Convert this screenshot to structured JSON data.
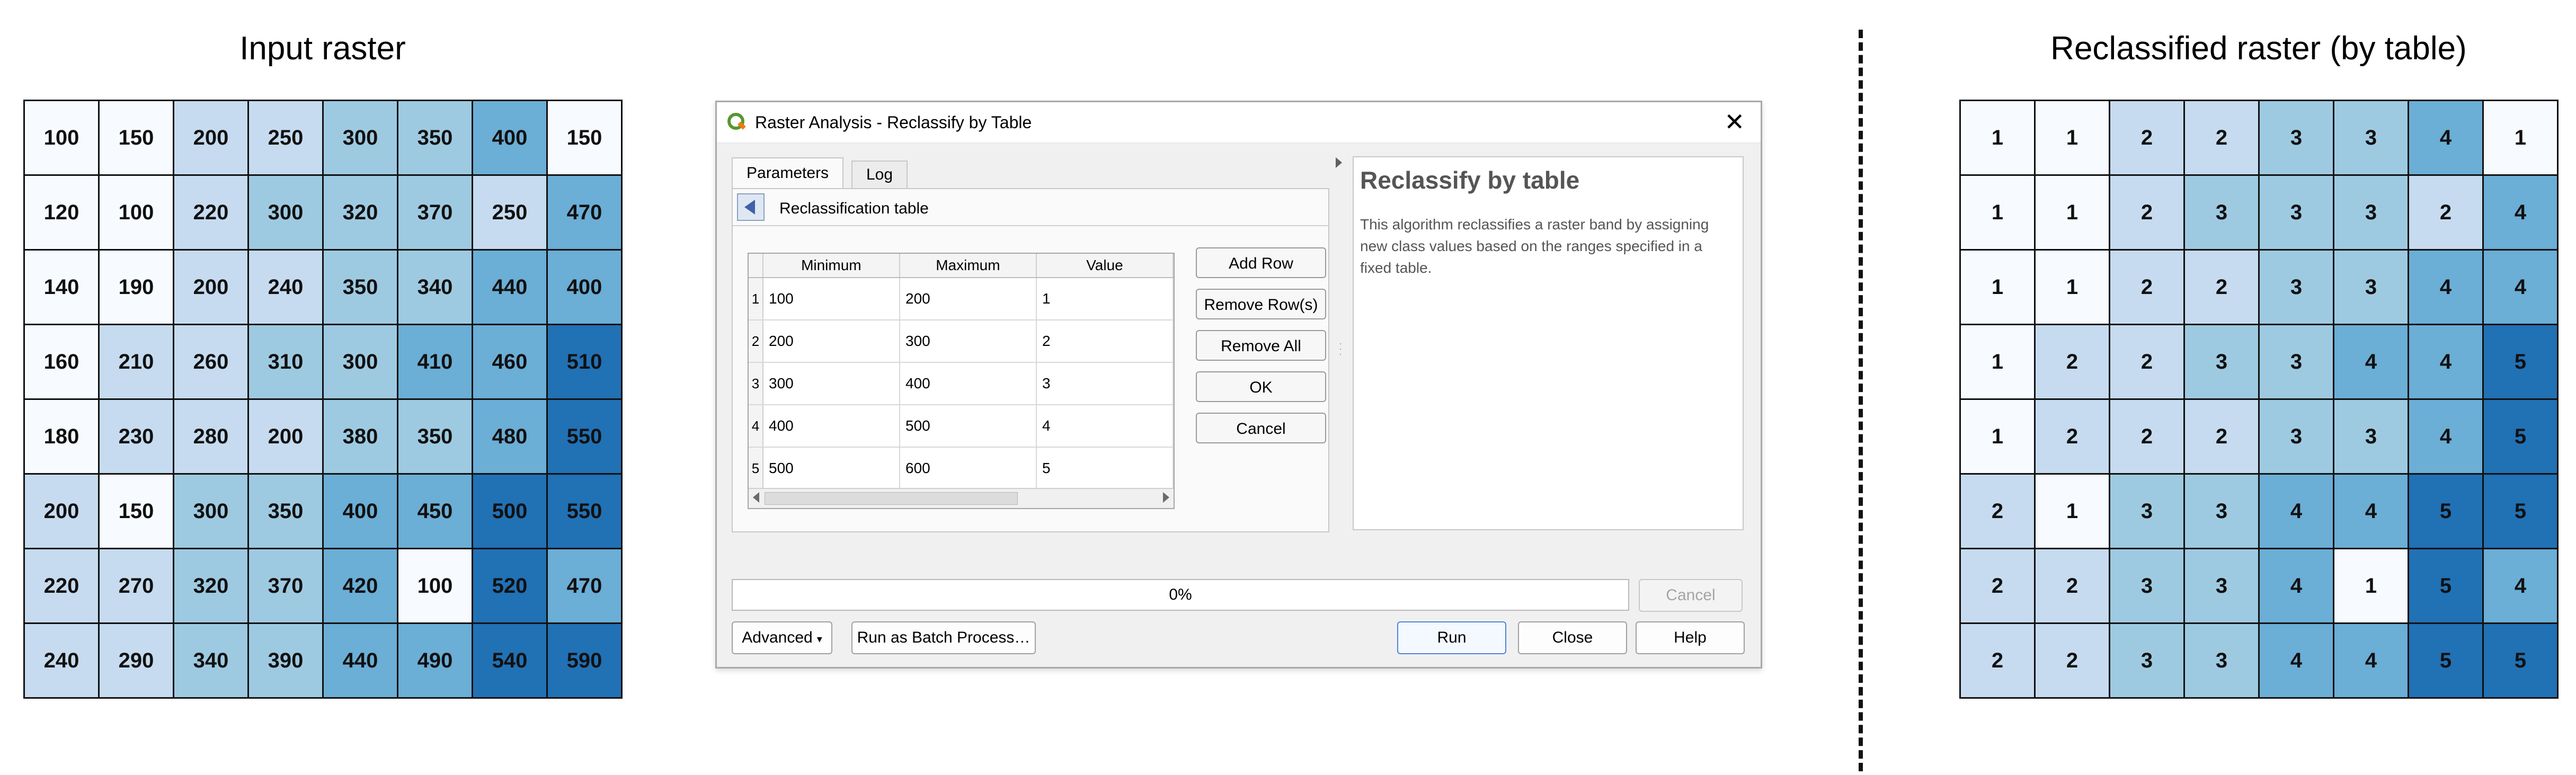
{
  "left_panel": {
    "title": "Input raster",
    "rows": [
      [
        "100",
        "150",
        "200",
        "250",
        "300",
        "350",
        "400",
        "150"
      ],
      [
        "120",
        "100",
        "220",
        "300",
        "320",
        "370",
        "250",
        "470"
      ],
      [
        "140",
        "190",
        "200",
        "240",
        "350",
        "340",
        "440",
        "400"
      ],
      [
        "160",
        "210",
        "260",
        "310",
        "300",
        "410",
        "460",
        "510"
      ],
      [
        "180",
        "230",
        "280",
        "200",
        "380",
        "350",
        "480",
        "550"
      ],
      [
        "200",
        "150",
        "300",
        "350",
        "400",
        "450",
        "500",
        "550"
      ],
      [
        "220",
        "270",
        "320",
        "370",
        "420",
        "100",
        "520",
        "470"
      ],
      [
        "240",
        "290",
        "340",
        "390",
        "440",
        "490",
        "540",
        "590"
      ]
    ]
  },
  "right_panel": {
    "title": "Reclassified raster (by table)",
    "rows": [
      [
        "1",
        "1",
        "2",
        "2",
        "3",
        "3",
        "4",
        "1"
      ],
      [
        "1",
        "1",
        "2",
        "3",
        "3",
        "3",
        "2",
        "4"
      ],
      [
        "1",
        "1",
        "2",
        "2",
        "3",
        "3",
        "4",
        "4"
      ],
      [
        "1",
        "2",
        "2",
        "3",
        "3",
        "4",
        "4",
        "5"
      ],
      [
        "1",
        "2",
        "2",
        "2",
        "3",
        "3",
        "4",
        "5"
      ],
      [
        "2",
        "1",
        "3",
        "3",
        "4",
        "4",
        "5",
        "5"
      ],
      [
        "2",
        "2",
        "3",
        "3",
        "4",
        "1",
        "5",
        "4"
      ],
      [
        "2",
        "2",
        "3",
        "3",
        "4",
        "4",
        "5",
        "5"
      ]
    ]
  },
  "class_colors": {
    "1": "#f7fbff",
    "2": "#c6dbef",
    "3": "#9ecae1",
    "4": "#6baed6",
    "5": "#2171b5"
  },
  "dialog": {
    "title": "Raster Analysis - Reclassify by Table",
    "close_icon": "close-icon",
    "tabs": [
      "Parameters",
      "Log"
    ],
    "section_label": "Reclassification table",
    "table": {
      "headers": [
        "Minimum",
        "Maximum",
        "Value"
      ],
      "rows": [
        [
          "1",
          "100",
          "200",
          "1"
        ],
        [
          "2",
          "200",
          "300",
          "2"
        ],
        [
          "3",
          "300",
          "400",
          "3"
        ],
        [
          "4",
          "400",
          "500",
          "4"
        ],
        [
          "5",
          "500",
          "600",
          "5"
        ]
      ]
    },
    "table_buttons": {
      "add_row": "Add Row",
      "remove_rows": "Remove Row(s)",
      "remove_all": "Remove All",
      "ok": "OK",
      "cancel": "Cancel"
    },
    "help": {
      "title": "Reclassify by table",
      "text": "This algorithm reclassifies a raster band by assigning new class values based on the ranges specified in a fixed table."
    },
    "progress": {
      "text": "0%",
      "value": 0
    },
    "cancel_label": "Cancel",
    "footer": {
      "advanced": "Advanced",
      "batch": "Run as Batch Process…",
      "run": "Run",
      "close": "Close",
      "help": "Help"
    }
  }
}
